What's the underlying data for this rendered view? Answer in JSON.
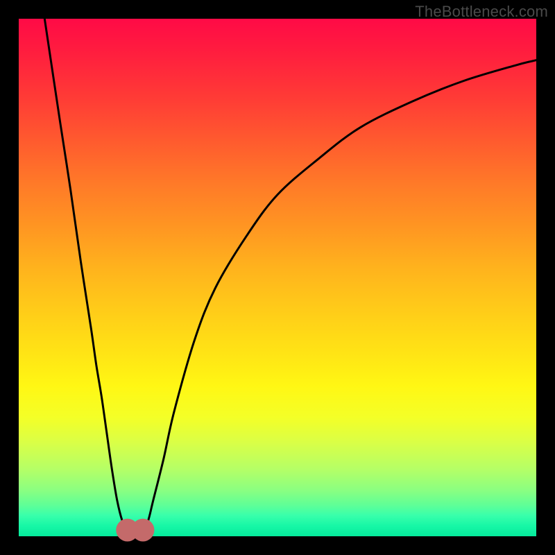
{
  "watermark": "TheBottleneck.com",
  "colors": {
    "frame": "#000000",
    "curve": "#000000",
    "marker": "#c46a6a",
    "gradient_top": "#ff0a46",
    "gradient_bottom": "#05eb9c"
  },
  "chart_data": {
    "type": "line",
    "title": "",
    "xlabel": "",
    "ylabel": "",
    "xlim": [
      0,
      100
    ],
    "ylim": [
      0,
      100
    ],
    "series": [
      {
        "name": "bottleneck-curve",
        "x": [
          5,
          8,
          10,
          12,
          14,
          15,
          16,
          17,
          18,
          19,
          20,
          21,
          22,
          23,
          24,
          25,
          26,
          28,
          30,
          34,
          38,
          44,
          50,
          58,
          66,
          76,
          86,
          96,
          100
        ],
        "y": [
          100,
          80,
          67,
          53,
          40,
          33,
          27,
          20,
          13,
          7,
          3,
          1,
          0.5,
          0.5,
          1,
          3,
          7,
          15,
          24,
          38,
          48,
          58,
          66,
          73,
          79,
          84,
          88,
          91,
          92
        ]
      }
    ],
    "markers": [
      {
        "name": "min-left",
        "x": 21,
        "y": 1.2
      },
      {
        "name": "min-right",
        "x": 24,
        "y": 1.2
      }
    ],
    "marker_radius": 2.2
  }
}
